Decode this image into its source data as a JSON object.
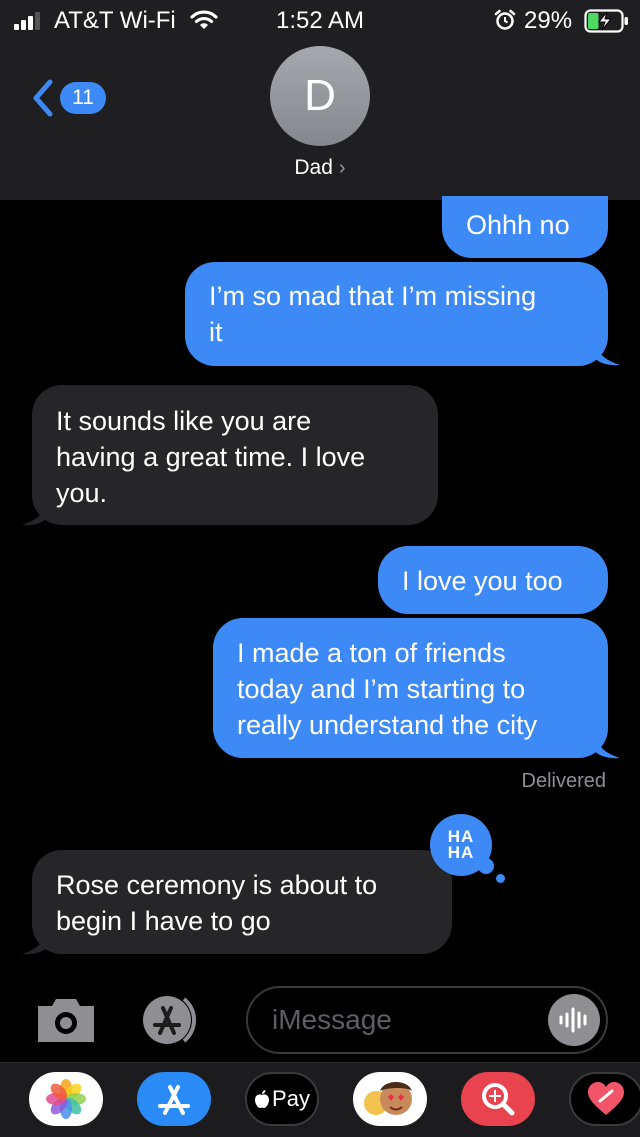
{
  "status_bar": {
    "carrier": "AT&T Wi-Fi",
    "time": "1:52 AM",
    "battery_percent": "29%",
    "signal_bars": 3,
    "battery_level": 0.29,
    "icons": [
      "signal-icon",
      "wifi-icon",
      "alarm-icon",
      "battery-charging-icon"
    ]
  },
  "header": {
    "back_count": "11",
    "avatar_initial": "D",
    "contact_name": "Dad",
    "chevron": "›"
  },
  "messages": [
    {
      "from": "me",
      "text": "Ohhh no"
    },
    {
      "from": "me",
      "text": "I’m so mad that I’m missing\nit"
    },
    {
      "from": "them",
      "text": "It sounds like you are\nhaving a great time. I love\nyou."
    },
    {
      "from": "me",
      "text": "I love you too"
    },
    {
      "from": "me",
      "text": "I made a ton of friends\ntoday and I’m starting to\nreally understand the city"
    },
    {
      "from": "them",
      "text": "Rose ceremony is about to\nbegin I have to go"
    }
  ],
  "delivered_label": "Delivered",
  "tapback": {
    "type": "haha",
    "line1": "HA",
    "line2": "HA"
  },
  "input": {
    "placeholder": "iMessage"
  },
  "app_drawer": {
    "apps": [
      {
        "name": "photos-app-icon"
      },
      {
        "name": "app-store-icon"
      },
      {
        "name": "apple-pay-icon",
        "label": "Pay"
      },
      {
        "name": "memoji-stickers-icon"
      },
      {
        "name": "web-images-search-icon"
      },
      {
        "name": "digital-touch-icon"
      }
    ]
  },
  "colors": {
    "accent_blue": "#3d8af7",
    "incoming_bubble": "#262628",
    "header_bg": "#1f1f21",
    "background": "#000000"
  }
}
